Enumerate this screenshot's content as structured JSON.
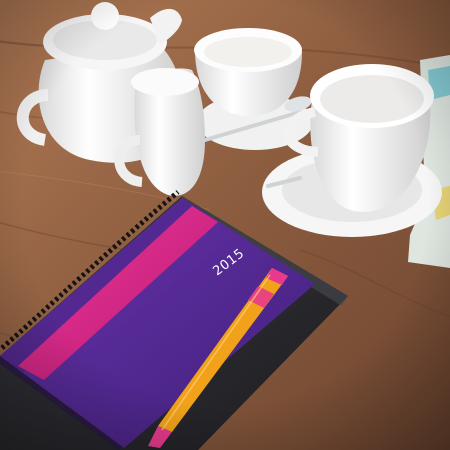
{
  "notebook": {
    "cover_year": "2015"
  },
  "colors": {
    "table_wood": "#9a6a48",
    "porcelain": "#f4f3f1",
    "notebook_purple": "#5a2a98",
    "notebook_pink": "#e0268c",
    "black_folder": "#2a2a2e",
    "pen_orange": "#f2a21a",
    "pen_pink": "#e63a8a"
  }
}
